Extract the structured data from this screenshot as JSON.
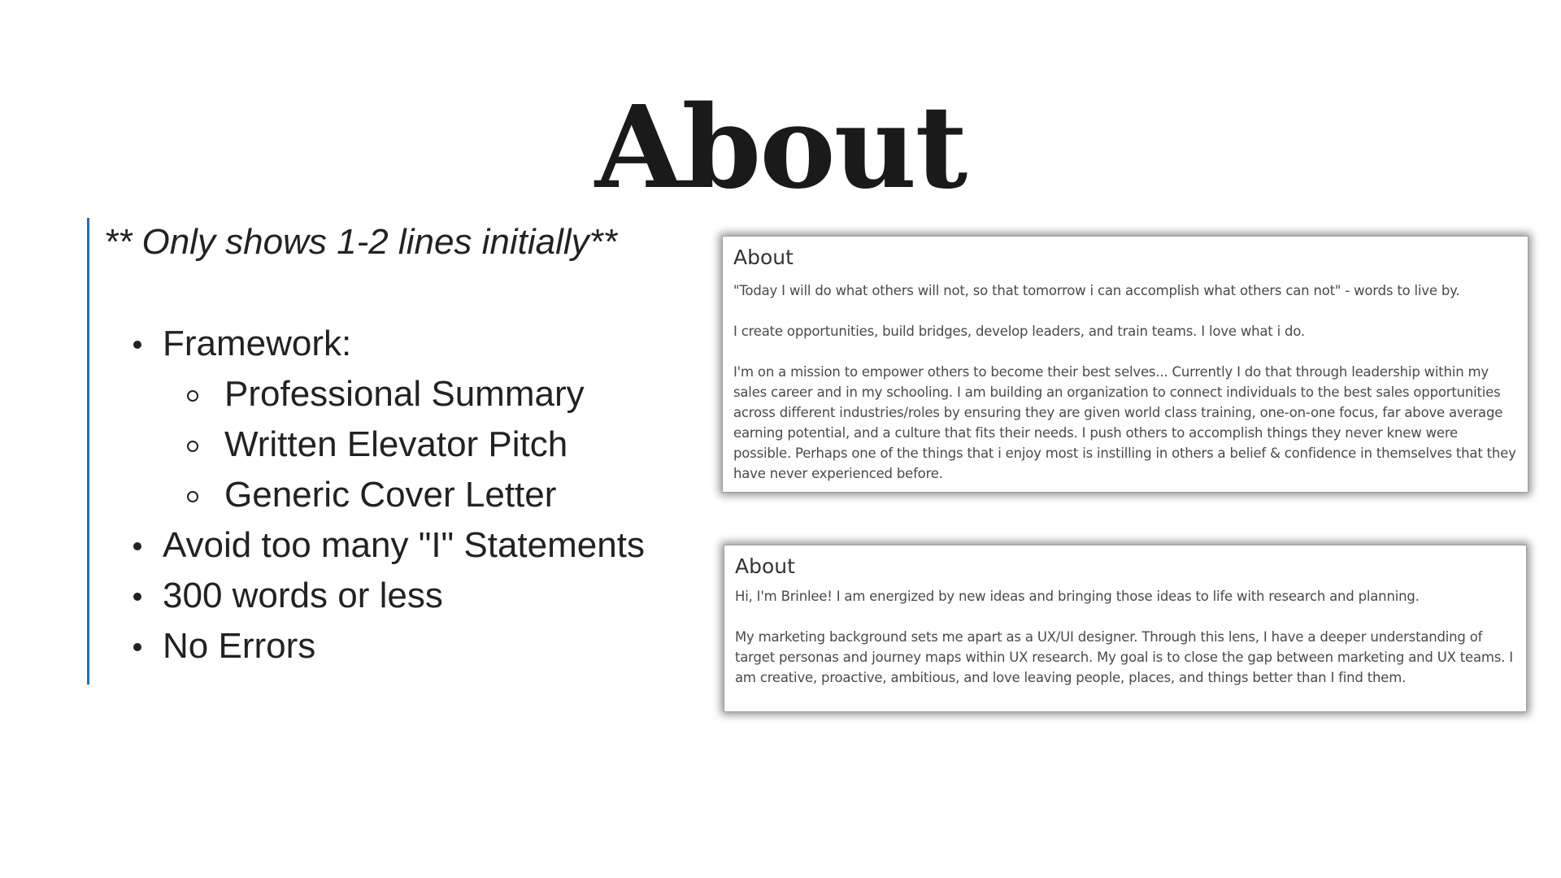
{
  "slide": {
    "title": "About"
  },
  "left": {
    "note": "** Only shows 1-2 lines initially**",
    "bullets": [
      {
        "label": "Framework:",
        "sub": [
          "Professional Summary",
          "Written Elevator Pitch",
          "Generic Cover Letter"
        ]
      },
      {
        "label": "Avoid too many \"I\" Statements"
      },
      {
        "label": "300 words or less"
      },
      {
        "label": "No Errors"
      }
    ]
  },
  "examples": [
    {
      "heading": "About",
      "paragraphs": [
        "\"Today I will do what others will not, so that tomorrow i can accomplish what others can not\" - words to live by.",
        "I create opportunities, build bridges, develop leaders, and train teams. I love what i do.",
        "I'm on a mission to empower others to become their best selves... Currently I do that through leadership within my sales career and in my schooling. I am building an organization to connect individuals to the best sales opportunities across different industries/roles by ensuring they are given world class training, one-on-one focus, far above average earning potential, and a culture that fits their needs. I push others to accomplish things they never knew were possible. Perhaps one of the things that i enjoy most is instilling in others a belief & confidence in themselves that they have never experienced before."
      ]
    },
    {
      "heading": "About",
      "paragraphs": [
        "Hi, I'm Brinlee! I am energized by new ideas and bringing those ideas to life with research and planning.",
        "My marketing background sets me apart as a UX/UI designer. Through this lens, I have a deeper understanding of target personas and journey maps within UX research. My goal is to close the gap between marketing and UX teams. I am creative, proactive, ambitious, and love leaving people, places, and things better than I find them."
      ]
    }
  ],
  "colors": {
    "accent_bar": "#1f6fc6",
    "text": "#222222"
  }
}
